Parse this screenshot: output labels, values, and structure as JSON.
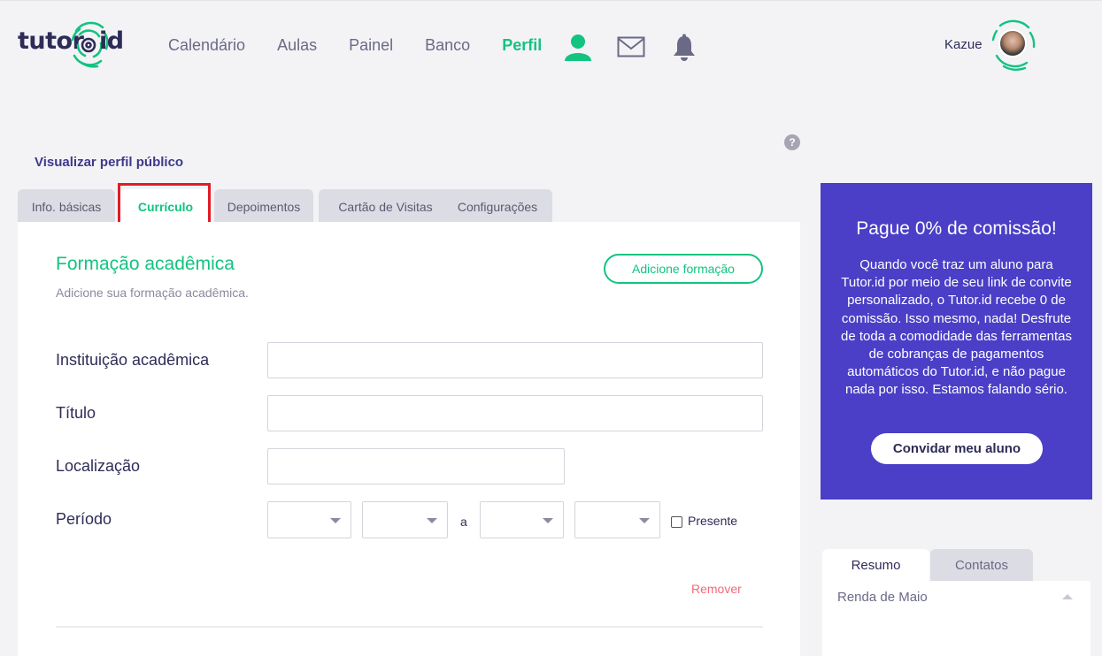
{
  "brand": {
    "left": "tutor",
    "right": "id",
    "accent": "#13c380",
    "dark": "#2e2c57"
  },
  "nav": [
    {
      "label": "Calendário",
      "active": false
    },
    {
      "label": "Aulas",
      "active": false
    },
    {
      "label": "Painel",
      "active": false
    },
    {
      "label": "Banco",
      "active": false
    },
    {
      "label": "Perfil",
      "active": true
    }
  ],
  "nav_icons": [
    "user-icon",
    "mail-icon",
    "bell-icon"
  ],
  "user": {
    "name": "Kazue"
  },
  "help": {
    "glyph": "?"
  },
  "public_profile_link": "Visualizar perfil público",
  "tabs": [
    {
      "label": "Info. básicas",
      "active": false
    },
    {
      "label": "Currículo",
      "active": true
    },
    {
      "label": "Depoimentos",
      "active": false
    },
    {
      "label": "Cartão de Visitas",
      "active": false
    },
    {
      "label": "Configurações",
      "active": false
    }
  ],
  "section": {
    "title": "Formação acadêmica",
    "subtitle": "Adicione sua formação acadêmica.",
    "add_button": "Adicione formação"
  },
  "form": {
    "institution_label": "Instituição acadêmica",
    "institution_value": "",
    "title_label": "Título",
    "title_value": "",
    "location_label": "Localização",
    "location_value": "",
    "period_label": "Período",
    "period_separator": "a",
    "present_label": "Presente",
    "present_checked": false,
    "remove_label": "Remover"
  },
  "promo": {
    "title": "Pague 0% de comissão!",
    "text": "Quando você traz um aluno para Tutor.id por meio de seu link de convite personalizado, o Tutor.id recebe 0 de comissão. Isso mesmo, nada! Desfrute de toda a comodidade das ferramentas de cobranças de pagamentos automáticos do Tutor.id, e não pague nada por isso. Estamos falando sério.",
    "button": "Convidar meu aluno",
    "bg": "#4a3fc6"
  },
  "side_tabs": [
    {
      "label": "Resumo",
      "active": true
    },
    {
      "label": "Contatos",
      "active": false
    }
  ],
  "side_panel": {
    "title": "Renda de Maio"
  }
}
